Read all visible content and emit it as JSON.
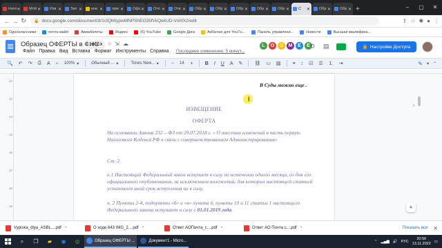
{
  "browser": {
    "tabs": [
      {
        "label": "Нато",
        "color": "#e53935"
      },
      {
        "label": "Мой",
        "color": "#e53935"
      },
      {
        "label": "Изв",
        "color": "#4285f4"
      },
      {
        "label": "Зап",
        "color": "#4285f4"
      },
      {
        "label": "инв",
        "color": "#fbbc04"
      },
      {
        "label": "прм",
        "color": "#4285f4"
      },
      {
        "label": "Офс",
        "color": "#4285f4"
      },
      {
        "label": "Ото",
        "color": "#4285f4"
      },
      {
        "label": "Отв",
        "color": "#4285f4"
      },
      {
        "label": "Обр",
        "color": "#4285f4"
      },
      {
        "label": "Обр",
        "color": "#4285f4"
      },
      {
        "label": "Обр",
        "color": "#4285f4"
      },
      {
        "label": "Обр",
        "color": "#4285f4"
      },
      {
        "label": "Обр",
        "color": "#4285f4"
      },
      {
        "label": "С",
        "color": "#4285f4",
        "active": true
      },
      {
        "label": "Обр",
        "color": "#4285f4"
      },
      {
        "label": "Обр",
        "color": "#4285f4"
      }
    ],
    "url": "docs.google.com/document/d/1ctQMIypwMNPShEO35fVkQekUD-VshfX2/edit",
    "bookmarks": [
      {
        "label": "Одноклассники",
        "color": "#f7931e"
      },
      {
        "label": "почта майл",
        "color": "#168de2"
      },
      {
        "label": "Авиабилеты",
        "color": "#e53935"
      },
      {
        "label": "Яндекс",
        "color": "#ff0000"
      },
      {
        "label": "(6) YouTube",
        "color": "#ff0000"
      },
      {
        "label": "Google Диск",
        "color": "#34a853"
      },
      {
        "label": "AdSense для YouTu...",
        "color": "#fbbc04"
      },
      {
        "label": "Панель управлени...",
        "color": "#4285f4"
      },
      {
        "label": "Новости",
        "color": "#4285f4"
      },
      {
        "label": "Высшая квалифика...",
        "color": "#4285f4"
      }
    ]
  },
  "docs": {
    "title": "Образец ОФЕРТЫ в ФНС",
    "badge": ".DOCX",
    "menu": [
      "Файл",
      "Правка",
      "Вид",
      "Вставка",
      "Формат",
      "Инструменты",
      "Справка"
    ],
    "last_edit": "Последнее изменение: 5 минут...",
    "share_label": "Настройки Доступа",
    "extension_letters": [
      {
        "char": "L",
        "color": "#43a047"
      },
      {
        "char": "O",
        "color": "#e53935"
      },
      {
        "char": "O",
        "color": "#fbbc04"
      },
      {
        "char": "M",
        "color": "#8e24aa"
      },
      {
        "char": "E",
        "color": "#1e88e5"
      },
      {
        "char": "E",
        "color": "#43a047"
      }
    ],
    "toolbar": {
      "zoom": "100%",
      "style": "Обычный ...",
      "font": "Times New...",
      "size": "14"
    }
  },
  "document": {
    "top_line": "В Суды можно еще .",
    "heading1": "ИЗВЕЩЕНИЕ",
    "heading2": "ОФЕРТА",
    "para1": "На основании Закона 232 – ФЗ от 29.07.2018 г. « О внесении изменений в часть первую Налогового Кодекса РФ в связи с совершенствованием Администрирования»",
    "art": "Ст. 2",
    "para2": "п.1    Настоящий Федеральный закон вступает в силу по истечении одного месяца, со дня его официального опубликования, за исключением положений, для которых настоящей статьей установлен иной срок вступления их в силу.",
    "para3a": "п. 2    Пункты 2-4, подпункты «б» и «в» пункта 6, пункты 10 и 11 статьи 1 настоящего Федерального закона вступают в силу с",
    "para3b": "01.01.2019 года.",
    "ruler_numbers": [
      "12",
      "13",
      "14",
      "15",
      "16",
      "17",
      "18",
      "19",
      "20"
    ]
  },
  "downloads": [
    {
      "name": "Vypiska_dlya_ASBL....pdf"
    },
    {
      "name": "О ходе 643 IMG_2....pdf"
    },
    {
      "name": "Ответ АОПочта_с....pdf"
    },
    {
      "name": "Ответ АО Почта с....pdf"
    }
  ],
  "downloads_all": "Показать все",
  "taskbar": {
    "windows": [
      {
        "label": "Образец ОФЕРТЫ ...",
        "color": "#4285f4",
        "active": true
      },
      {
        "label": "Документ1 - Micro...",
        "color": "#2b579a"
      }
    ],
    "lang": "РУС",
    "time": "20:56",
    "date": "13.11.2022"
  }
}
